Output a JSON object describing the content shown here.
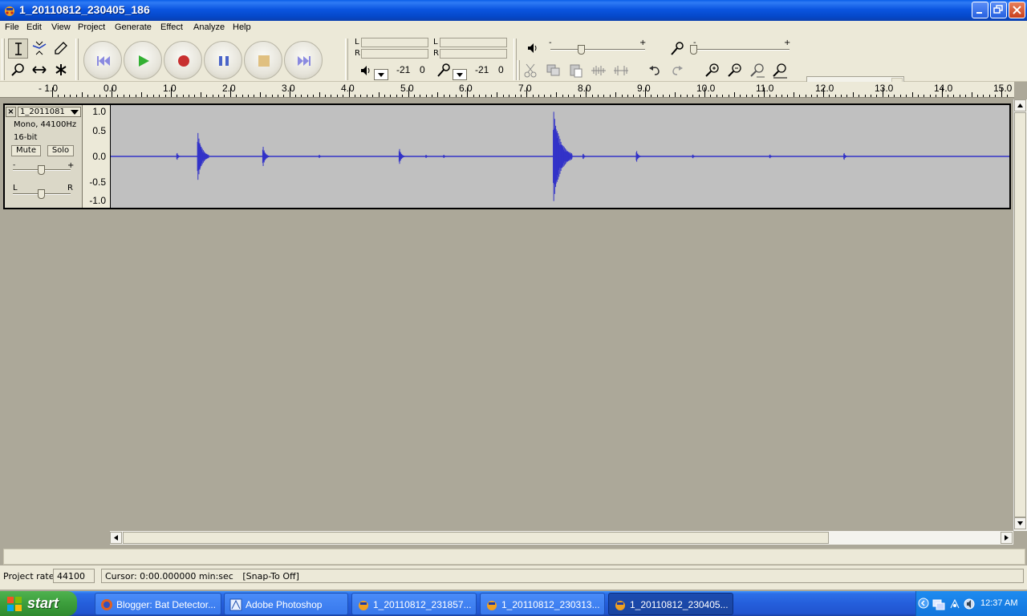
{
  "window": {
    "title": "1_20110812_230405_186"
  },
  "menu": [
    "File",
    "Edit",
    "View",
    "Project",
    "Generate",
    "Effect",
    "Analyze",
    "Help"
  ],
  "tools": [
    "selection-tool",
    "envelope-tool",
    "draw-tool",
    "zoom-tool",
    "time-shift-tool",
    "multi-tool"
  ],
  "transport": [
    "skip-to-start",
    "play",
    "record",
    "pause",
    "stop",
    "skip-to-end"
  ],
  "meters": {
    "play": {
      "left": "L",
      "right": "R",
      "db_min": "-21",
      "db_max": "0"
    },
    "record": {
      "left": "L",
      "right": "R",
      "db_min": "-21",
      "db_max": "0"
    }
  },
  "mixer": {
    "out_minus": "-",
    "out_plus": "+",
    "in_minus": "-",
    "in_plus": "+"
  },
  "ruler": {
    "labels": [
      "- 1.0",
      "0.0",
      "1.0",
      "2.0",
      "3.0",
      "4.0",
      "5.0",
      "6.0",
      "7.0",
      "8.0",
      "9.0",
      "10.0",
      "11.0",
      "12.0",
      "13.0",
      "14.0",
      "15.0"
    ]
  },
  "track": {
    "name": "1_2011081",
    "format": "Mono, 44100Hz",
    "bit_depth": "16-bit",
    "mute_label": "Mute",
    "solo_label": "Solo",
    "gain_minus": "-",
    "gain_plus": "+",
    "pan_left": "L",
    "pan_right": "R",
    "close": "×",
    "vruler_labels": [
      "1.0",
      "0.5",
      "0.0",
      "-0.5",
      "-1.0"
    ],
    "wave_color": "#3232c8",
    "bg_color": "#c0c0c0",
    "spikes": [
      {
        "t": 1.1,
        "amp": 0.1
      },
      {
        "t": 1.45,
        "amp": 0.55
      },
      {
        "t": 2.55,
        "amp": 0.25
      },
      {
        "t": 3.5,
        "amp": 0.05
      },
      {
        "t": 4.85,
        "amp": 0.2
      },
      {
        "t": 5.3,
        "amp": 0.05
      },
      {
        "t": 5.6,
        "amp": 0.05
      },
      {
        "t": 7.45,
        "amp": 1.0
      },
      {
        "t": 7.95,
        "amp": 0.08
      },
      {
        "t": 8.85,
        "amp": 0.15
      },
      {
        "t": 9.8,
        "amp": 0.06
      },
      {
        "t": 11.1,
        "amp": 0.06
      },
      {
        "t": 12.35,
        "amp": 0.1
      }
    ]
  },
  "status": {
    "project_rate_label": "Project rate:",
    "project_rate": "44100",
    "cursor": "Cursor: 0:00.000000 min:sec",
    "snap": "[Snap-To Off]"
  },
  "taskbar": {
    "start": "start",
    "tasks": [
      {
        "label": "Blogger: Bat Detector...",
        "active": false
      },
      {
        "label": "Adobe Photoshop",
        "active": false
      },
      {
        "label": "1_20110812_231857...",
        "active": false
      },
      {
        "label": "1_20110812_230313...",
        "active": false
      },
      {
        "label": "1_20110812_230405...",
        "active": true
      }
    ],
    "clock": "12:37 AM"
  }
}
